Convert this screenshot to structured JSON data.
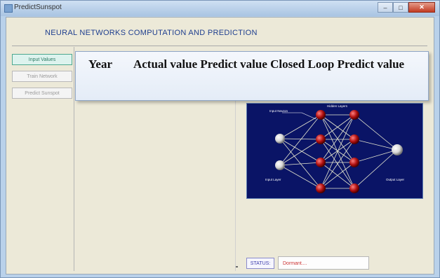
{
  "window": {
    "title": "PredictSunspot",
    "controls": {
      "minimize": "–",
      "maximize": "□",
      "close": "✕"
    }
  },
  "app": {
    "heading": "NEURAL NETWORKS COMPUTATION AND PREDICTION"
  },
  "sidebar": {
    "items": [
      {
        "label": "Input Values",
        "active": true
      },
      {
        "label": "Train Network",
        "active": false
      },
      {
        "label": "Predict Sunspot",
        "active": false
      }
    ]
  },
  "overlay_table": {
    "headers": [
      "Year",
      "Actual value",
      "Predict value",
      "Closed Loop Predict value"
    ]
  },
  "network_diagram": {
    "labels": {
      "input_neuron": "Input Neuron",
      "hidden_layers": "Hidden Layers",
      "input_layer": "Input Layer",
      "output_layer": "Output Layer"
    },
    "colors": {
      "background": "#0a1466",
      "hidden_node": "#b01010",
      "io_node": "#d8d8d8",
      "connection": "#e8e8d0"
    }
  },
  "status": {
    "label": "STATUS:",
    "value": "Dormant....",
    "value_color": "#cc3333"
  }
}
